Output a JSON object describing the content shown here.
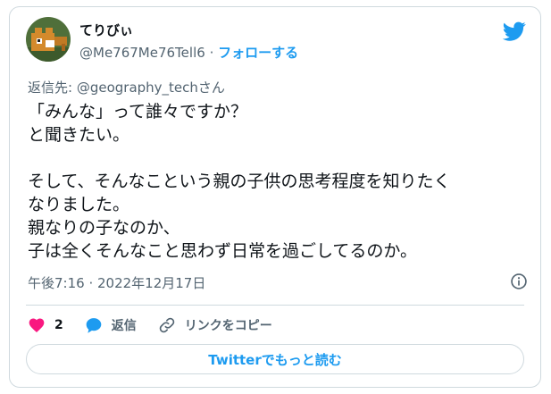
{
  "author": {
    "display_name": "てりびぃ",
    "handle": "@Me767Me76Tell6",
    "separator": "·",
    "follow_label": "フォローする"
  },
  "reply_to": "返信先: @geography_techさん",
  "tweet": {
    "text": "「みんな」って誰々ですか？\nと聞きたい。\n\nそして、そんなこという親の子供の思考程度を知りたく\nなりました。\n親なりの子なのか、\n子は全くそんなこと思わず日常を過ごしてるのか。",
    "timestamp": "午後7:16 · 2022年12月17日"
  },
  "actions": {
    "like_count": "2",
    "reply_label": "返信",
    "copy_link_label": "リンクをコピー"
  },
  "read_more_label": "Twitterでもっと読む",
  "colors": {
    "accent": "#1d9bf0",
    "like": "#f91880",
    "secondary_text": "#536471",
    "border": "#cfd9de"
  }
}
